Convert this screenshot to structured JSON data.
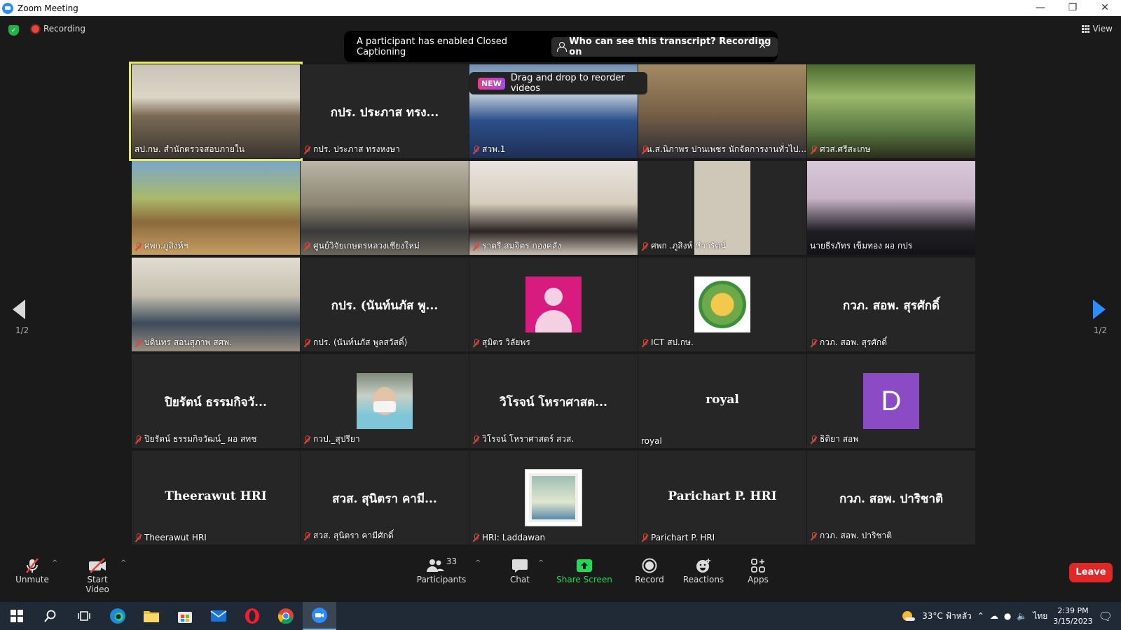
{
  "window": {
    "title": "Zoom Meeting",
    "minimize": "—",
    "restore": "❐",
    "close": "✕"
  },
  "top": {
    "recording": "Recording",
    "view": "View"
  },
  "cc_banner": {
    "message": "A participant has enabled Closed Captioning",
    "link": "Who can see this transcript? Recording on",
    "close": "×"
  },
  "tip": {
    "badge": "NEW",
    "text": "Drag and drop to reorder videos"
  },
  "pager": {
    "left": "1/2",
    "right": "1/2"
  },
  "tiles": [
    {
      "label": "สป.กษ. สำนักตรวจสอบภายใน",
      "big": "",
      "muted": false,
      "bg": "v-room"
    },
    {
      "label": "กปร. ประภาส ทรงหงษา",
      "big": "กปร. ประภาส ทรง...",
      "muted": true,
      "bg": ""
    },
    {
      "label": "สวพ.1",
      "big": "",
      "muted": true,
      "bg": "v-blue"
    },
    {
      "label": "น.ส.นิภาพร ปานเพชร นักจัดการงานทั่วไป...",
      "big": "",
      "muted": true,
      "bg": "v-wood"
    },
    {
      "label": "ศวส.ศรีสะเกษ",
      "big": "",
      "muted": true,
      "bg": "v-green"
    },
    {
      "label": "ศพก.ภูสิงห์ฯ",
      "big": "",
      "muted": true,
      "bg": "v-mural"
    },
    {
      "label": "ศูนย์วิจัยเกษตรหลวงเชียงใหม่",
      "big": "",
      "muted": true,
      "bg": "v-office"
    },
    {
      "label": "ราตรี สมจิตร กองคลัง",
      "big": "",
      "muted": true,
      "bg": "v-lady"
    },
    {
      "label": "ศพก .ภูสิงห์ ชีวารัตน์",
      "big": "",
      "muted": true,
      "bg": "v-narrow"
    },
    {
      "label": "นายธีรภัทร เข็มทอง ผอ กปร",
      "big": "",
      "muted": false,
      "bg": "v-suit"
    },
    {
      "label": "บดินทร สอนสุภาพ สศพ.",
      "big": "",
      "muted": true,
      "bg": "v-man"
    },
    {
      "label": "กปร. (นันท์นภัส พูลสวัสดิ์)",
      "big": "กปร. (นันท์นภัส พู...",
      "muted": true,
      "bg": ""
    },
    {
      "label": "สุมิตร วิลัยพร",
      "big": "",
      "muted": true,
      "bg": "",
      "avatar": "pink"
    },
    {
      "label": "ICT สป.กษ.",
      "big": "",
      "muted": true,
      "bg": "",
      "avatar": "seal"
    },
    {
      "label": "กวภ. สอพ. สุรศักดิ์",
      "big": "กวภ. สอพ. สุรศักดิ์",
      "muted": true,
      "bg": ""
    },
    {
      "label": "ปิยรัตน์ ธรรมกิจวัฒน์_ ผอ สทช",
      "big": "ปิยรัตน์ ธรรมกิจวั...",
      "muted": true,
      "bg": ""
    },
    {
      "label": "กวป._สุปรียา",
      "big": "",
      "muted": true,
      "bg": "",
      "avatar": "mask"
    },
    {
      "label": "วิโรจน์ โหราศาสตร์ สวส.",
      "big": "วิโรจน์ โหราศาสต...",
      "muted": true,
      "bg": ""
    },
    {
      "label": "royal",
      "big": "royal",
      "muted": false,
      "bg": ""
    },
    {
      "label": "ธิติยา สอพ",
      "big": "",
      "muted": true,
      "bg": "",
      "avatar": "D"
    },
    {
      "label": "Theerawut HRI",
      "big": "Theerawut HRI",
      "muted": true,
      "bg": ""
    },
    {
      "label": "สวส. สุนิตรา คามีศักดิ์",
      "big": "สวส. สุนิตรา คามี...",
      "muted": true,
      "bg": ""
    },
    {
      "label": "HRI: Laddawan",
      "big": "",
      "muted": true,
      "bg": "",
      "avatar": "photo"
    },
    {
      "label": "Parichart P. HRI",
      "big": "Parichart P. HRI",
      "muted": true,
      "bg": ""
    },
    {
      "label": "กวภ. สอพ. ปาริชาติ",
      "big": "กวภ. สอพ. ปาริชาติ",
      "muted": true,
      "bg": ""
    }
  ],
  "toolbar": {
    "unmute": "Unmute",
    "start_video": "Start Video",
    "participants": "Participants",
    "participants_count": "33",
    "chat": "Chat",
    "share": "Share Screen",
    "record": "Record",
    "reactions": "Reactions",
    "apps": "Apps",
    "leave": "Leave"
  },
  "taskbar": {
    "weather": "33°C ฟ้าหลัว",
    "lang": "ไทย",
    "time": "2:39 PM",
    "date": "3/15/2023"
  },
  "colors": {
    "accent": "#2d8cff",
    "share": "#23d959",
    "leave": "#e02828",
    "active_outline": "#e6ec52",
    "muted": "#e0453a"
  }
}
